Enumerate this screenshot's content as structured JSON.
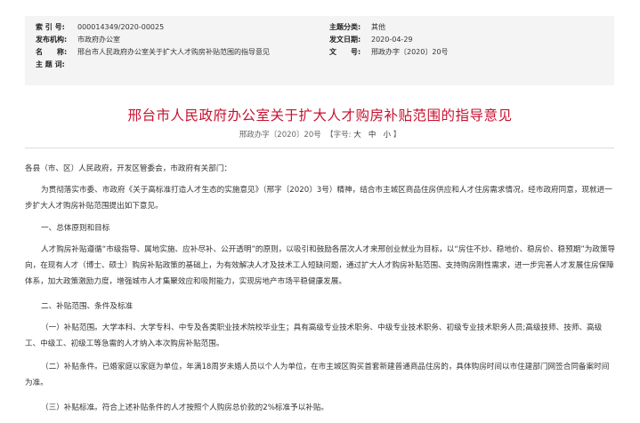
{
  "meta": {
    "index_no_label": "索 引 号:",
    "index_no": "000014349/2020-00025",
    "theme_label": "主题分类:",
    "theme": "其他",
    "publisher_label": "发布机构:",
    "publisher": "市政府办公室",
    "date_label": "发文日期:",
    "date": "2020-04-29",
    "name_label": "名　　称:",
    "name": "邢台市人民政府办公室关于扩大人才购房补贴范围的指导意见",
    "doc_no_label": "文　　号:",
    "doc_no": "邢政办字〔2020〕20号",
    "keywords_label": "主 题 词:",
    "keywords": ""
  },
  "title": "邢台市人民政府办公室关于扩大人才购房补贴范围的指导意见",
  "subtitle": {
    "doc_no": "邢政办字〔2020〕20号",
    "font_size_prefix": "【字号:",
    "font_large": "大",
    "font_medium": "中",
    "font_small": "小",
    "font_size_suffix": "】"
  },
  "content": {
    "recipients": "各县（市、区）人民政府，开发区管委会，市政府有关部门：",
    "intro": "为贯彻落实市委、市政府《关于高标准打造人才生态的实施意见》（邢字〔2020〕3号）精神，结合市主城区商品住房供应和人才住房需求情况，经市政府同意，现就进一步扩大人才购房补贴范围提出如下意见。",
    "section1_heading": "一、总体原则和目标",
    "section1_body": "人才购房补贴遵循“市级指导、属地实施、应补尽补、公开透明”的原则，以吸引和鼓励各层次人才来邢创业就业为目标，以“房住不炒、稳地价、稳房价、稳预期”为政策导向，在现有人才（博士、硕士）购房补贴政策的基础上，为有效解决人才及技术工人短缺问题，通过扩大人才购房补贴范围、支持购房刚性需求，进一步完善人才发展住房保障体系，加大政策激励力度，增强城市人才集聚效应和吸附能力，实现房地产市场平稳健康发展。",
    "section2_heading": "二、补贴范围、条件及标准",
    "item1": "（一）补贴范围。大学本科、大学专科、中专及各类职业技术院校毕业生；具有高级专业技术职务、中级专业技术职务、初级专业技术职务人员;高级技师、技师、高级工、中级工、初级工等急需的人才纳入本次购房补贴范围。",
    "item2": "（二）补贴条件。已婚家庭以家庭为单位，年满18周岁未婚人员以个人为单位，在市主城区购买首套新建普通商品住房的，具体购房时间以市住建部门网签合同备案时间为准。",
    "item3": "（三）补贴标准。符合上述补贴条件的人才按照个人购房总价款的2%标准予以补贴。"
  }
}
